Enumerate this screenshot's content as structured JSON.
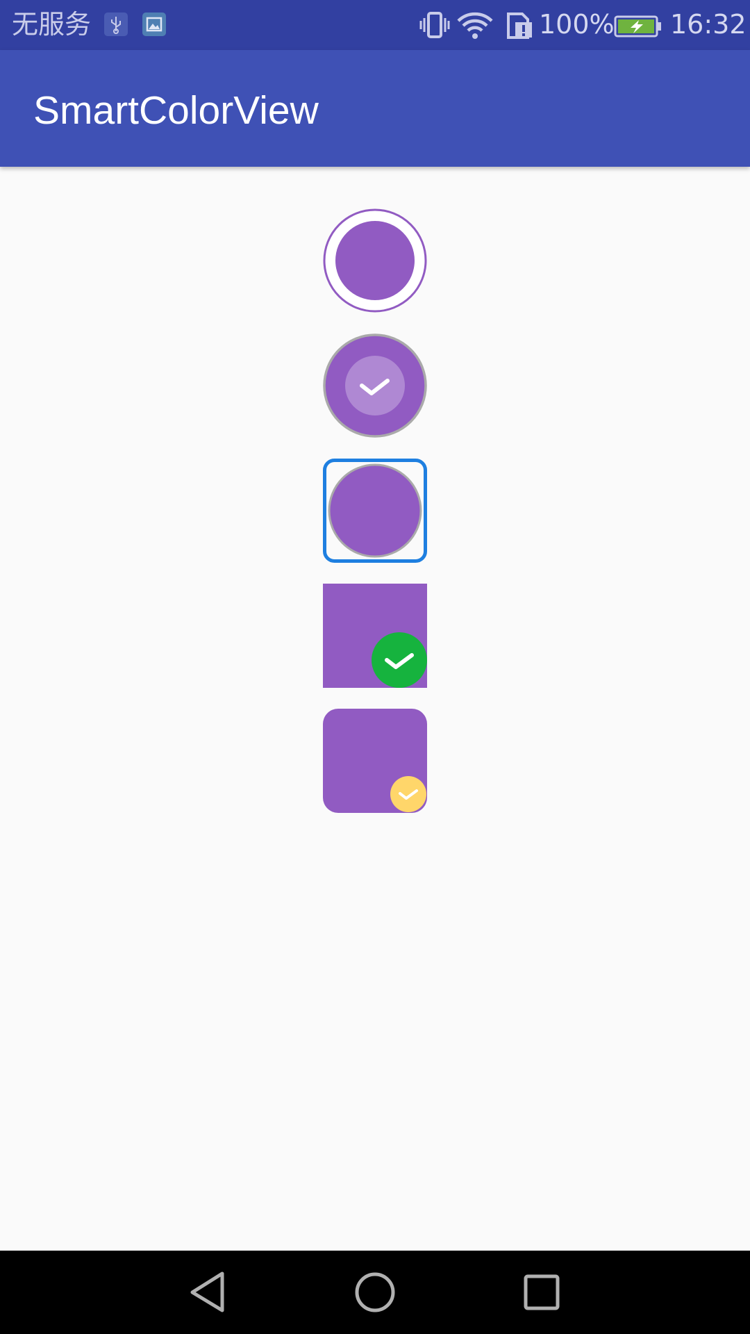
{
  "status_bar": {
    "carrier": "无服务",
    "battery_percent": "100%",
    "time": "16:32",
    "icons": [
      "usb-icon",
      "gallery-icon",
      "vibrate-icon",
      "wifi-icon",
      "sim-icon",
      "battery-charging-icon"
    ]
  },
  "app_bar": {
    "title": "SmartColorView"
  },
  "color_views": [
    {
      "shape": "circle",
      "style": "ring-outline",
      "checked": false,
      "fill_color": "#915bc2",
      "accent_color": "#915bc2"
    },
    {
      "shape": "circle",
      "style": "gray-border",
      "checked": true,
      "fill_color": "#915bc2",
      "check_badge": "translucent-white"
    },
    {
      "shape": "circle",
      "style": "selected-square-frame",
      "checked": false,
      "fill_color": "#915bc2",
      "frame_color": "#1e7fe0"
    },
    {
      "shape": "square",
      "style": "plain",
      "checked": true,
      "fill_color": "#915bc2",
      "check_badge_color": "#16b33e"
    },
    {
      "shape": "rounded-square",
      "style": "plain",
      "checked": true,
      "fill_color": "#915bc2",
      "check_badge_color": "#ffd66a"
    }
  ],
  "nav_bar": {
    "buttons": [
      "back",
      "home",
      "recents"
    ]
  },
  "colors": {
    "status_bar": "#3240a1",
    "app_bar": "#3f51b5",
    "background": "#fafafa",
    "swatch": "#915bc2"
  }
}
